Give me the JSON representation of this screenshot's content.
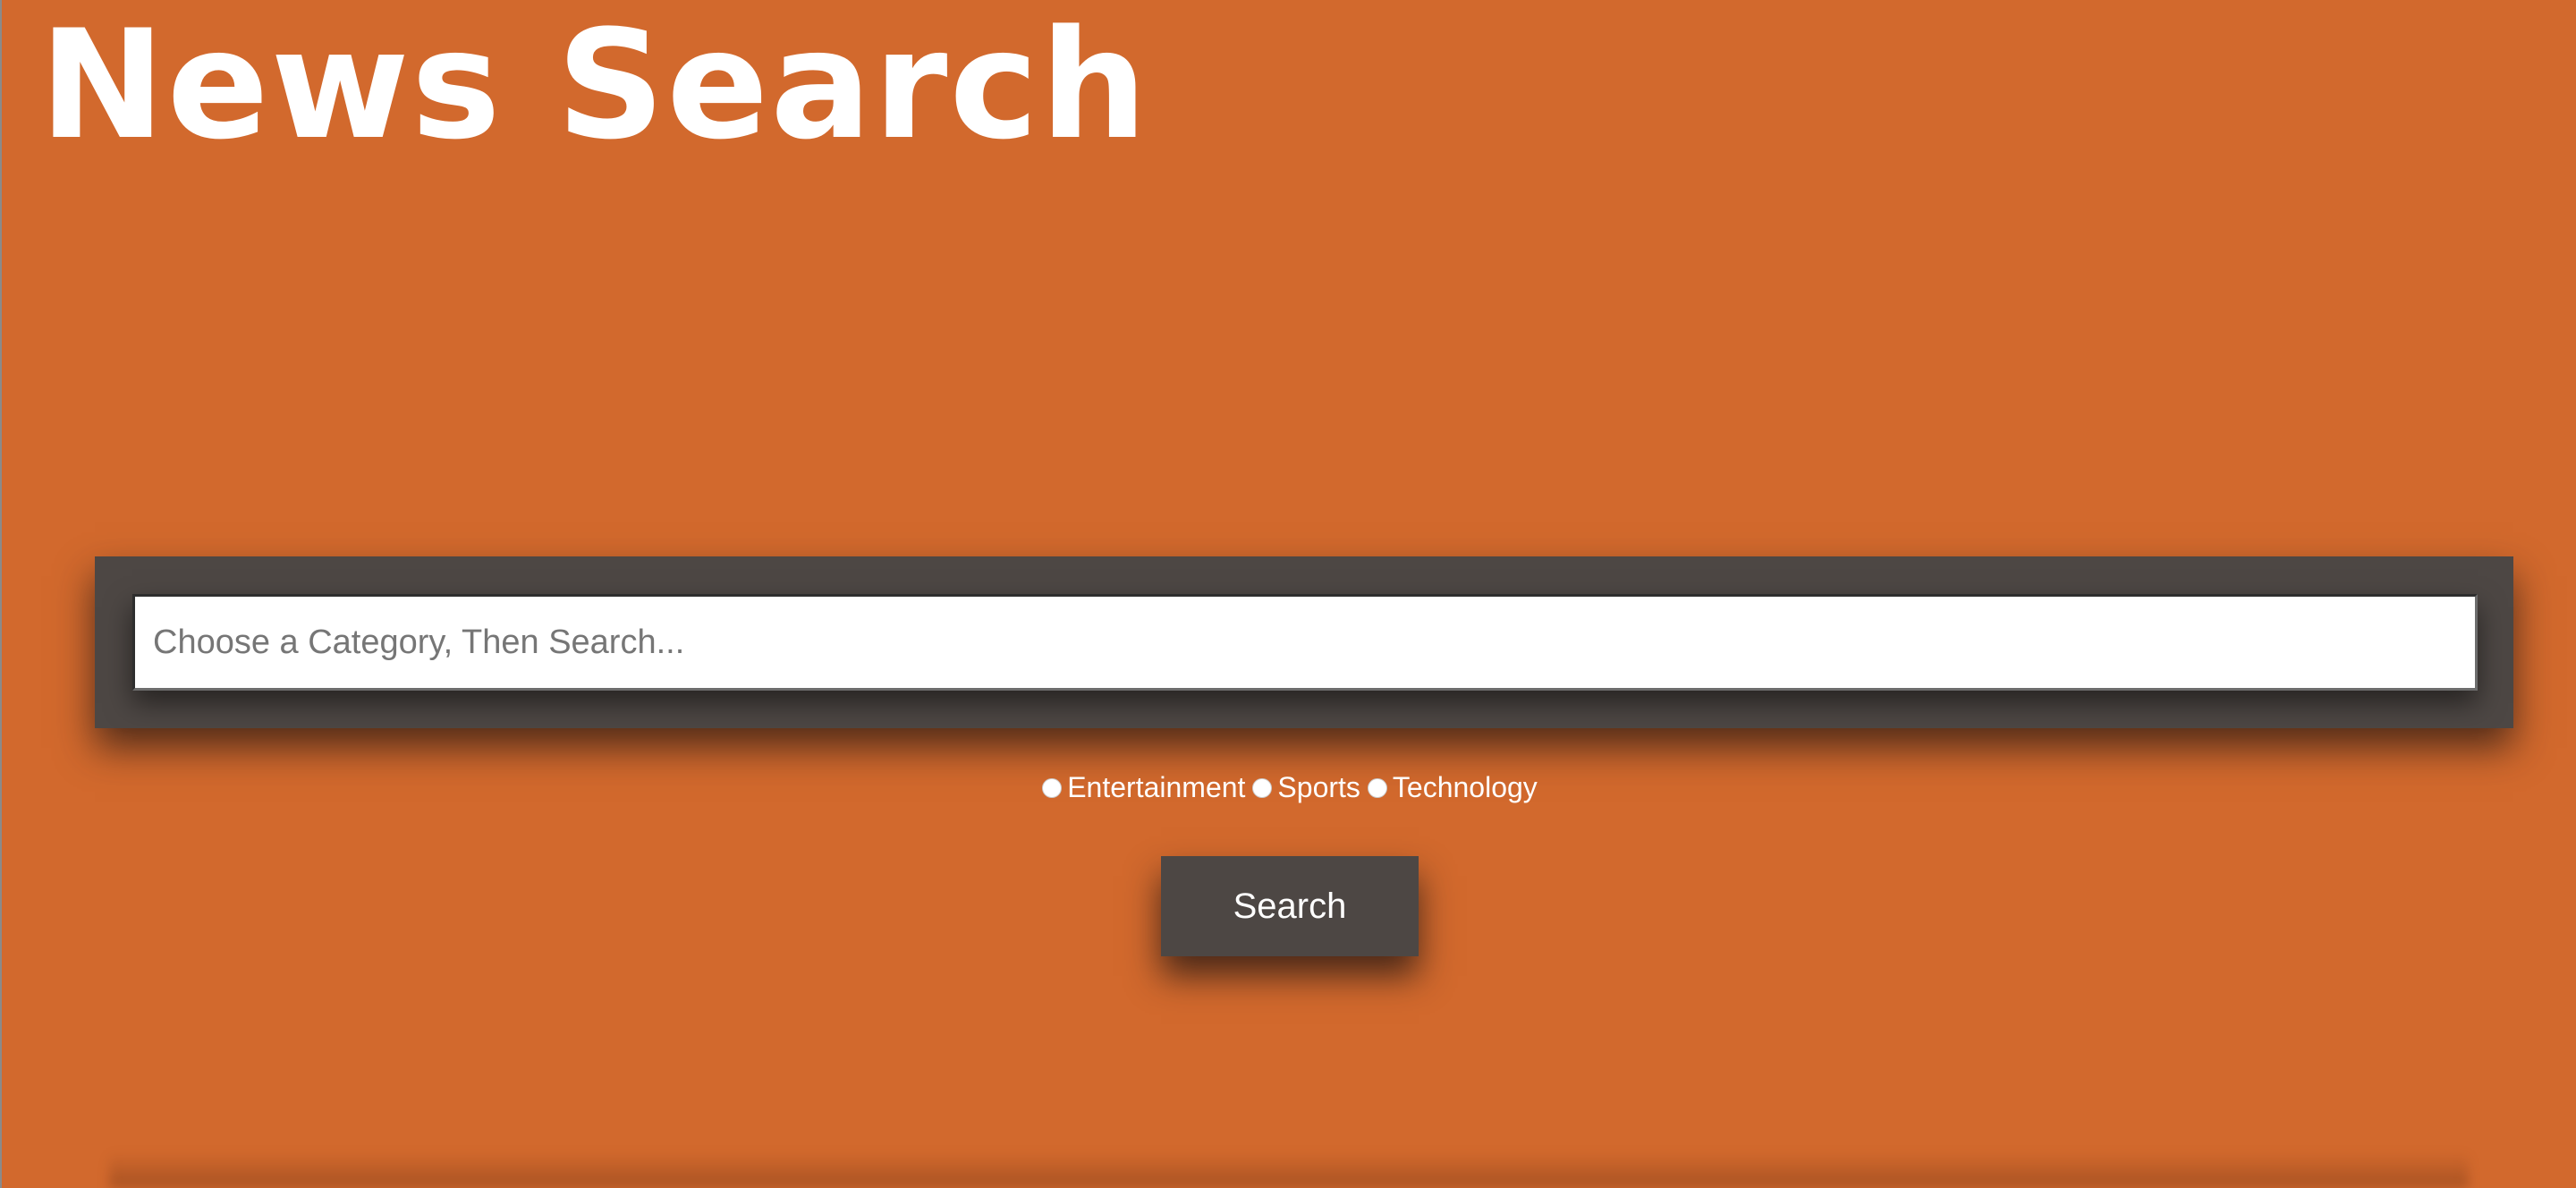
{
  "header": {
    "title": "News Search"
  },
  "search": {
    "placeholder": "Choose a Category, Then Search...",
    "value": ""
  },
  "categories": [
    {
      "label": "Entertainment",
      "selected": false
    },
    {
      "label": "Sports",
      "selected": false
    },
    {
      "label": "Technology",
      "selected": false
    }
  ],
  "search_button": {
    "label": "Search"
  },
  "colors": {
    "background": "#d2692d",
    "panel": "#4d4744",
    "text": "#ffffff"
  }
}
